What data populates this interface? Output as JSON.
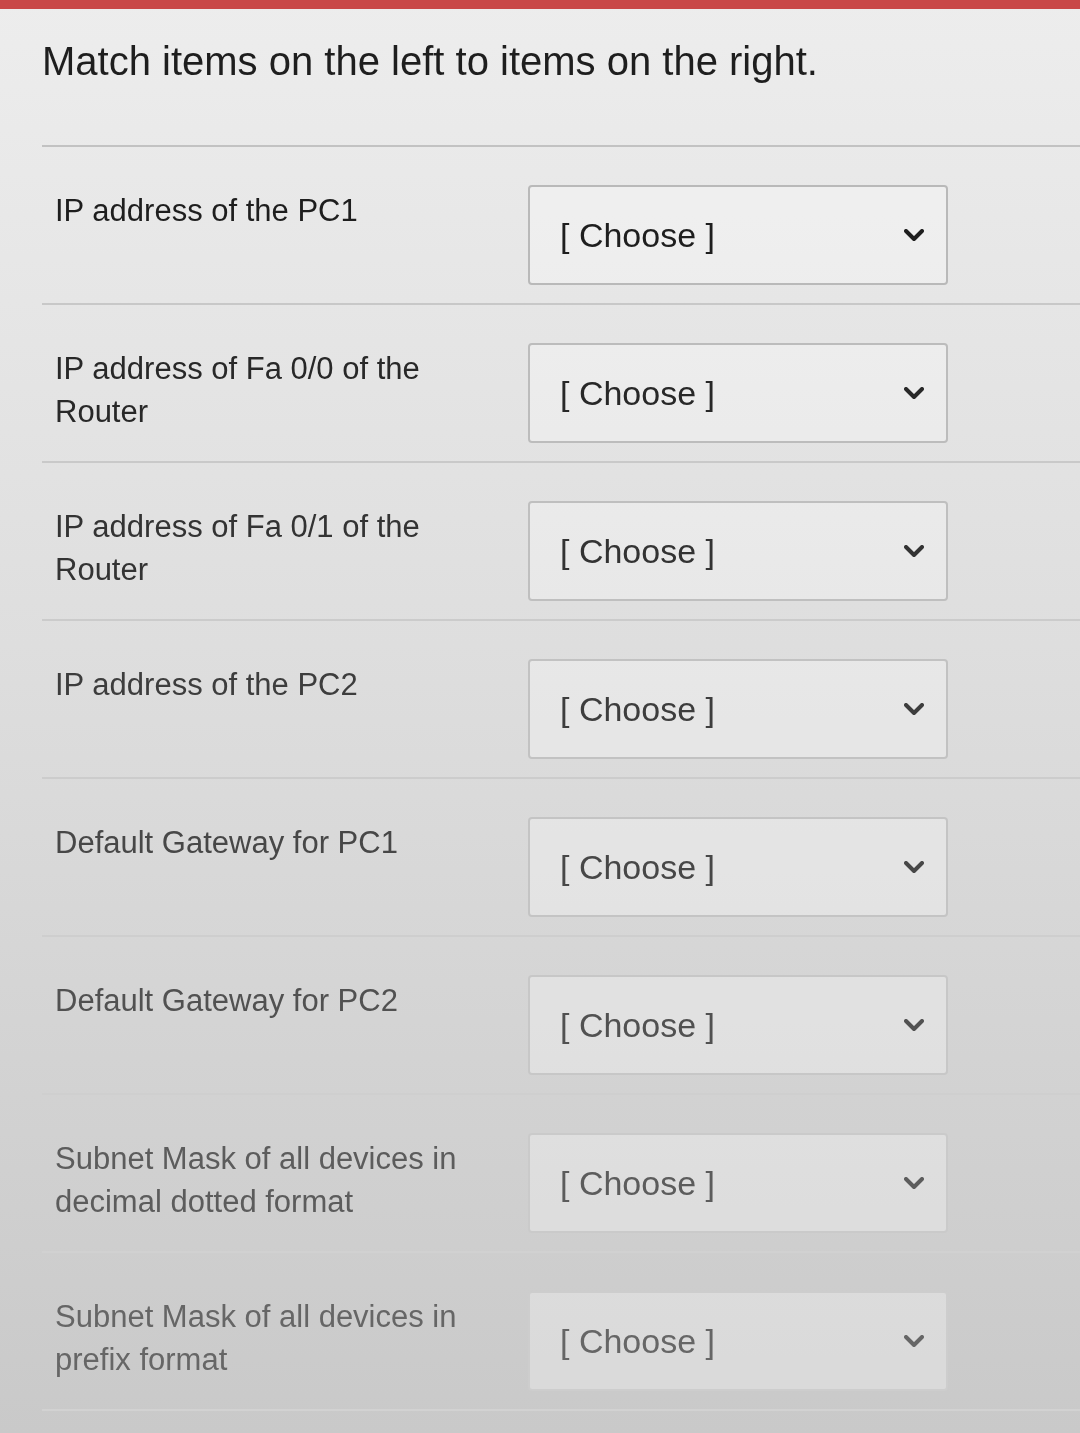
{
  "instruction": "Match items on the left to items on the right.",
  "rows": [
    {
      "prompt": "IP address of the PC1",
      "dropdown": {
        "value": "[ Choose ]"
      }
    },
    {
      "prompt": "IP address of Fa 0/0 of the Router",
      "dropdown": {
        "value": "[ Choose ]"
      }
    },
    {
      "prompt": "IP address of Fa 0/1 of the Router",
      "dropdown": {
        "value": "[ Choose ]"
      }
    },
    {
      "prompt": "IP address of the PC2",
      "dropdown": {
        "value": "[ Choose ]"
      }
    },
    {
      "prompt": "Default Gateway for PC1",
      "dropdown": {
        "value": "[ Choose ]"
      }
    },
    {
      "prompt": "Default Gateway for PC2",
      "dropdown": {
        "value": "[ Choose ]"
      }
    },
    {
      "prompt": "Subnet Mask of all devices in decimal dotted format",
      "dropdown": {
        "value": "[ Choose ]"
      }
    },
    {
      "prompt": "Subnet Mask of all devices in prefix format",
      "dropdown": {
        "value": "[ Choose ]"
      }
    }
  ]
}
